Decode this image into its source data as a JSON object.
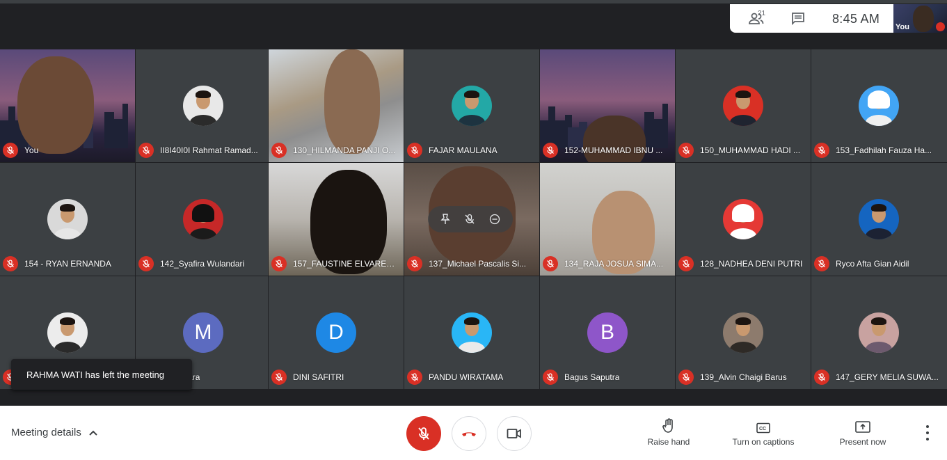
{
  "top_pill": {
    "people_count": "21",
    "clock": "8:45  AM",
    "self_label": "You"
  },
  "tiles": [
    {
      "name": "You",
      "kind": "video"
    },
    {
      "name": "II8I40I0I Rahmat Ramad...",
      "kind": "avatar"
    },
    {
      "name": "130_HILMANDA PANJI O...",
      "kind": "video"
    },
    {
      "name": "FAJAR MAULANA",
      "kind": "avatar"
    },
    {
      "name": "152-MUHAMMAD IBNU ...",
      "kind": "video"
    },
    {
      "name": "150_MUHAMMAD HADI ...",
      "kind": "avatar"
    },
    {
      "name": "153_Fadhilah Fauza Ha...",
      "kind": "avatar"
    },
    {
      "name": "154 - RYAN ERNANDA",
      "kind": "avatar"
    },
    {
      "name": "142_Syafira Wulandari",
      "kind": "avatar"
    },
    {
      "name": "157_FAUSTINE ELVARET...",
      "kind": "video"
    },
    {
      "name": "137_Michael Pascalis Si...",
      "kind": "video"
    },
    {
      "name": "134_RAJA JOSUA SIMA...",
      "kind": "video"
    },
    {
      "name": "128_NADHEA DENI PUTRI",
      "kind": "avatar"
    },
    {
      "name": "Ryco Afta Gian Aidil",
      "kind": "avatar"
    },
    {
      "name": "",
      "kind": "avatar"
    },
    {
      "name": "Bagaskara",
      "kind": "letter",
      "letter": "M"
    },
    {
      "name": "DINI SAFITRI",
      "kind": "letter",
      "letter": "D"
    },
    {
      "name": "PANDU WIRATAMA",
      "kind": "avatar"
    },
    {
      "name": "Bagus Saputra",
      "kind": "letter",
      "letter": "B"
    },
    {
      "name": "139_Alvin Chaigi Barus",
      "kind": "avatar"
    },
    {
      "name": "147_GERY MELIA SUWA...",
      "kind": "avatar"
    }
  ],
  "toast": {
    "text": "RAHMA WATI has left the meeting"
  },
  "bottom": {
    "meeting_details": "Meeting details",
    "raise_hand": "Raise hand",
    "captions": "Turn on captions",
    "present": "Present now"
  },
  "colors": {
    "background": "#202124",
    "tile": "#3c4043",
    "mic_off": "#d93025",
    "hangup_icon": "#d93025",
    "letter_m": "#5c6bc0",
    "letter_d": "#1e88e5",
    "letter_b": "#8e56c9"
  },
  "icons": {
    "people": "people-icon",
    "chat": "chat-icon",
    "mic_off": "mic-off-icon",
    "hangup": "phone-hangup-icon",
    "camera": "videocam-icon",
    "raise_hand": "hand-icon",
    "captions": "closed-captions-icon",
    "present": "present-screen-icon",
    "more": "more-vert-icon",
    "pin": "pin-icon",
    "minus": "remove-circle-icon"
  }
}
